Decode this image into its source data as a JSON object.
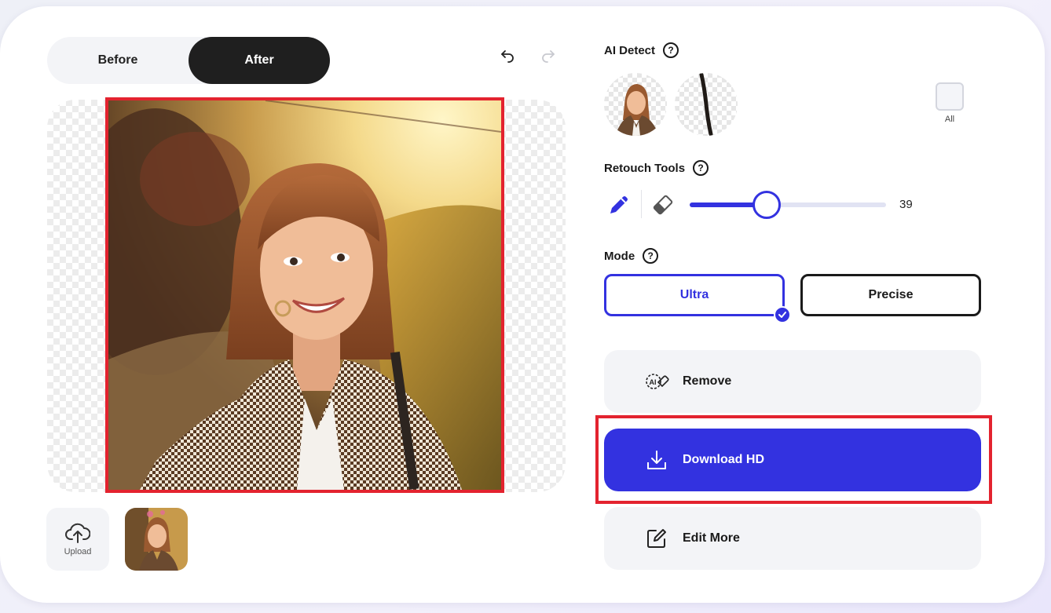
{
  "toggle": {
    "before_label": "Before",
    "after_label": "After",
    "selected": "After"
  },
  "ai_detect": {
    "title": "AI Detect",
    "help": "?",
    "all_label": "All"
  },
  "retouch": {
    "title": "Retouch Tools",
    "help": "?",
    "brush_size": 39,
    "brush_size_label": "39",
    "slider_min": 0,
    "slider_max": 100
  },
  "mode": {
    "title": "Mode",
    "help": "?",
    "ultra_label": "Ultra",
    "precise_label": "Precise",
    "selected": "Ultra"
  },
  "actions": {
    "remove_label": "Remove",
    "download_label": "Download HD",
    "edit_label": "Edit More"
  },
  "upload": {
    "label": "Upload"
  },
  "colors": {
    "accent": "#3332e0",
    "highlight": "#e3232f",
    "dark": "#1f1f1f",
    "panel": "#f3f4f7"
  }
}
